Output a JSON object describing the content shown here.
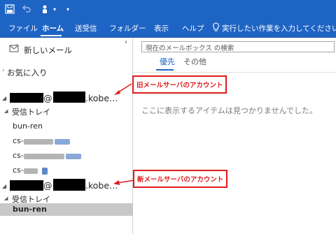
{
  "ribbon": {
    "tabs": [
      {
        "label": "ファイル"
      },
      {
        "label": "ホーム"
      },
      {
        "label": "送受信"
      },
      {
        "label": "フォルダー"
      },
      {
        "label": "表示"
      },
      {
        "label": "ヘルプ"
      }
    ],
    "active_tab": "ホーム",
    "tell_me": "実行したい作業を入力してください"
  },
  "folder_pane": {
    "new_mail": "新しいメール",
    "favorites": "お気に入り",
    "account1": {
      "name_visible_part": "@",
      "domain_visible_part": ".kobe…"
    },
    "account1_folders": {
      "inbox": "受信トレイ",
      "items": [
        "bun-ren",
        "cs-",
        "cs-",
        "cs-"
      ]
    },
    "account2": {
      "name_visible_part": "@",
      "domain_visible_part": ".kobe…"
    },
    "account2_folders": {
      "inbox": "受信トレイ",
      "items": [
        "bun-ren"
      ]
    }
  },
  "message_list": {
    "search_placeholder": "現在のメールボックス の検索",
    "filter_active": "優先",
    "filter_other": "その他",
    "empty_message": "ここに表示するアイテムは見つかりませんでした。"
  },
  "callouts": {
    "old_account": "旧メールサーバのアカウント",
    "new_account": "新メールサーバのアカウント"
  },
  "colors": {
    "ribbon": "#1e64c4",
    "callout": "#e01b1b",
    "selected_folder": "#c8c8c8"
  }
}
